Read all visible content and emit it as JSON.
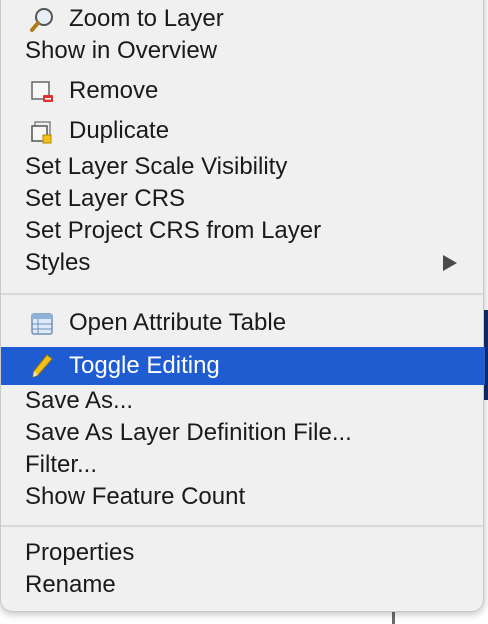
{
  "menu": {
    "group1": [
      {
        "label": "Zoom to Layer",
        "icon": "zoom-to-layer-icon"
      },
      {
        "label": "Show in Overview"
      },
      {
        "label": "Remove",
        "icon": "remove-layer-icon"
      },
      {
        "label": "Duplicate",
        "icon": "duplicate-layer-icon"
      },
      {
        "label": "Set Layer Scale Visibility"
      },
      {
        "label": "Set Layer CRS"
      },
      {
        "label": "Set Project CRS from Layer"
      },
      {
        "label": "Styles",
        "submenu": true
      }
    ],
    "group2": [
      {
        "label": "Open Attribute Table",
        "icon": "attribute-table-icon"
      },
      {
        "label": "Toggle Editing",
        "icon": "pencil-icon",
        "highlighted": true
      },
      {
        "label": "Save As..."
      },
      {
        "label": "Save As Layer Definition File..."
      },
      {
        "label": "Filter..."
      },
      {
        "label": "Show Feature Count"
      }
    ],
    "group3": [
      {
        "label": "Properties"
      },
      {
        "label": "Rename"
      }
    ]
  },
  "colors": {
    "highlight": "#1f5bd1",
    "menu_bg": "#f0f0f0",
    "text": "#1a1a1a"
  }
}
